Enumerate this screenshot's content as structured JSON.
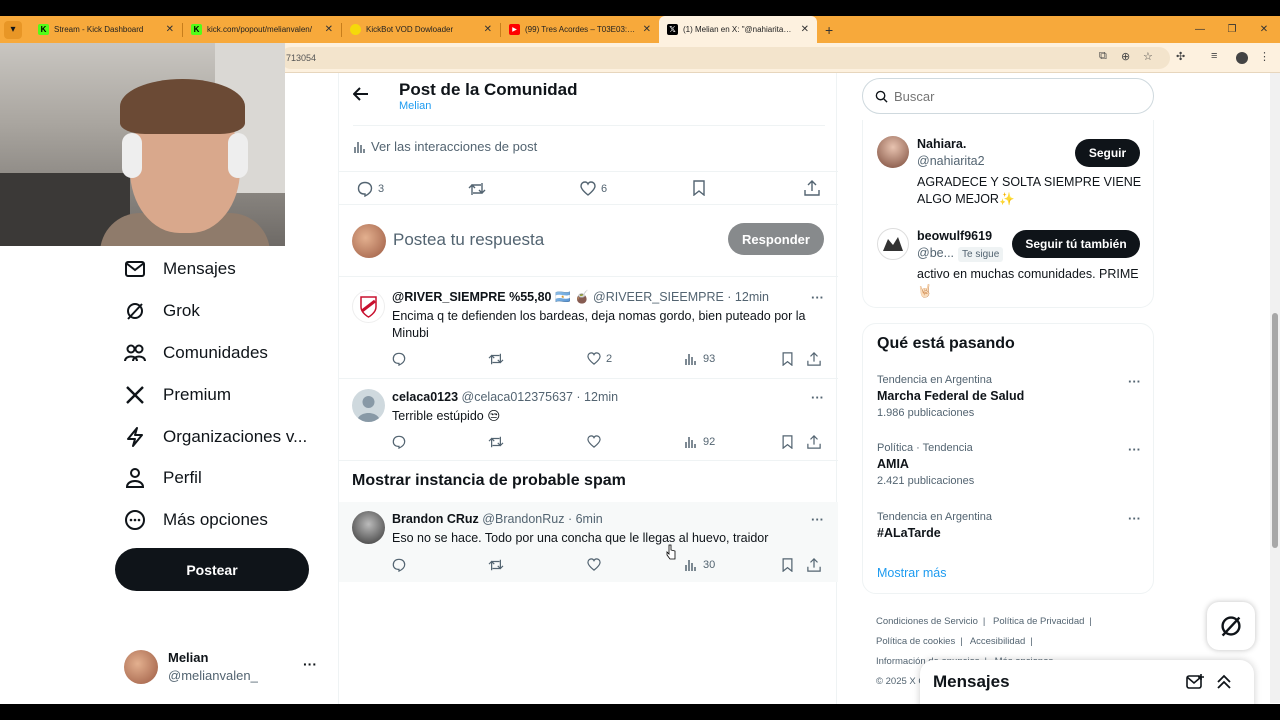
{
  "browser": {
    "tabs": [
      {
        "title": "Stream - Kick Dashboard",
        "favicon": "kick-icon"
      },
      {
        "title": "kick.com/popout/melianvalen/",
        "favicon": "kick-icon"
      },
      {
        "title": "KickBot VOD Dowloader",
        "favicon": "kickbot-icon"
      },
      {
        "title": "(99) Tres Acordes – T03E03: Es",
        "favicon": "youtube-icon"
      },
      {
        "title": "(1) Melian en X: \"@nahiarita2 @",
        "favicon": "x-icon",
        "active": true
      }
    ],
    "url_fragment": "713054"
  },
  "nav": {
    "items": [
      {
        "label": "Mensajes",
        "icon": "mail-icon"
      },
      {
        "label": "Grok",
        "icon": "grok-icon"
      },
      {
        "label": "Comunidades",
        "icon": "communities-icon"
      },
      {
        "label": "Premium",
        "icon": "x-logo-icon"
      },
      {
        "label": "Organizaciones v...",
        "icon": "lightning-icon"
      },
      {
        "label": "Perfil",
        "icon": "person-icon"
      },
      {
        "label": "Más opciones",
        "icon": "more-circle-icon"
      }
    ],
    "post_button": "Postear",
    "user": {
      "name": "Melian",
      "handle": "@melianvalen_"
    }
  },
  "header": {
    "title": "Post de la Comunidad",
    "subtitle": "Melian"
  },
  "main_post": {
    "interactions_label": "Ver las interacciones de post",
    "replies": "3",
    "likes": "6"
  },
  "reply_box": {
    "placeholder": "Postea tu respuesta",
    "button": "Responder"
  },
  "replies": [
    {
      "name": "@RIVER_SIEMPRE %55,80 🇦🇷 🧉",
      "handle": "@RIVEER_SIEEMPRE",
      "time": "· 12min",
      "text": "Encima q te defienden los bardeas, deja nomas gordo, bien puteado por la Minubi",
      "likes": "2",
      "views": "93"
    },
    {
      "name": "celaca0123",
      "handle": "@celaca012375637",
      "time": "· 12min",
      "text": "Terrible estúpido 😒",
      "likes": "",
      "views": "92"
    }
  ],
  "spam_section": {
    "title": "Mostrar instancia de probable spam"
  },
  "spam_reply": {
    "name": "Brandon CRuz",
    "handle": "@BrandonRuz",
    "time": "· 6min",
    "text": "Eso no se hace. Todo por una concha que le llegas al huevo, traidor",
    "views": "30"
  },
  "search": {
    "placeholder": "Buscar"
  },
  "related_users": [
    {
      "name": "Nahiara.",
      "handle": "@nahiarita2",
      "button": "Seguir",
      "bio": "AGRADECE Y SOLTA SIEMPRE VIENE ALGO MEJOR✨"
    },
    {
      "name": "beowulf9619",
      "handle": "@be...",
      "badge": "Te sigue",
      "button": "Seguir tú también",
      "bio": "activo en muchas comunidades. PRIME 🤘🏻"
    }
  ],
  "trends": {
    "title": "Qué está pasando",
    "items": [
      {
        "category": "Tendencia en Argentina",
        "name": "Marcha Federal de Salud",
        "count": "1.986 publicaciones"
      },
      {
        "category": "Política · Tendencia",
        "name": "AMIA",
        "count": "2.421 publicaciones"
      },
      {
        "category": "Tendencia en Argentina",
        "name": "#ALaTarde",
        "count": ""
      }
    ],
    "show_more": "Mostrar más"
  },
  "footer": {
    "links": [
      "Condiciones de Servicio",
      "|",
      "Política de Privacidad",
      "|",
      "Política de cookies",
      "|",
      "Accesibilidad",
      "|",
      "Información de anuncios",
      "|",
      "Más opciones ..."
    ],
    "copyright": "© 2025 X C"
  },
  "messages_drawer": {
    "title": "Mensajes"
  }
}
